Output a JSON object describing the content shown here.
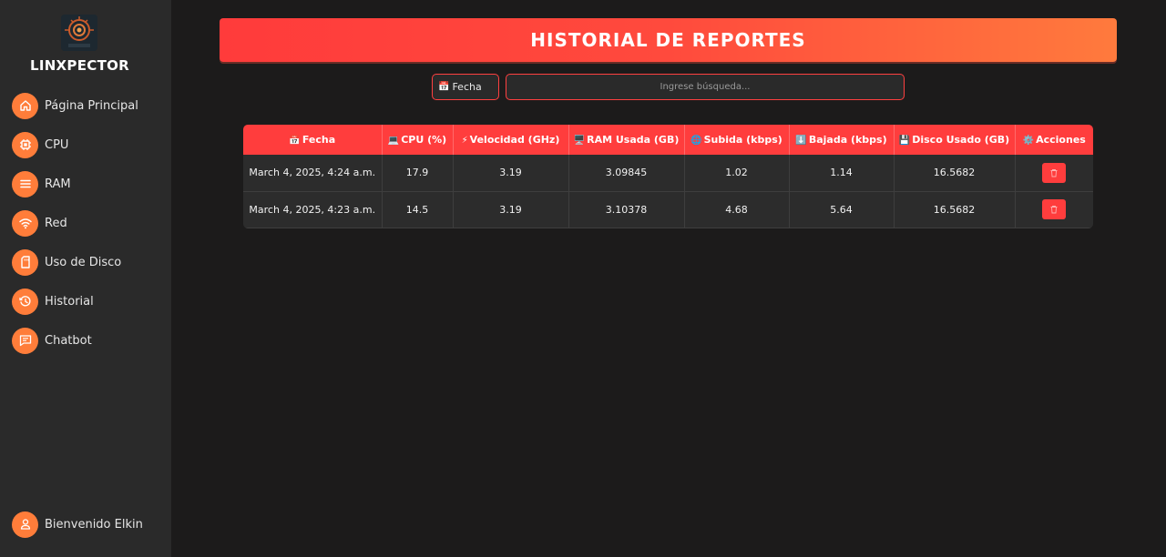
{
  "app": {
    "brand": "LINXPECTOR",
    "logo_text": "LINXPECTOR"
  },
  "sidebar": {
    "items": [
      {
        "label": "Página Principal",
        "icon": "home-icon"
      },
      {
        "label": "CPU",
        "icon": "cpu-icon"
      },
      {
        "label": "RAM",
        "icon": "list-icon"
      },
      {
        "label": "Red",
        "icon": "wifi-icon"
      },
      {
        "label": "Uso de Disco",
        "icon": "sd-card-icon"
      },
      {
        "label": "Historial",
        "icon": "history-icon"
      },
      {
        "label": "Chatbot",
        "icon": "chat-icon"
      }
    ],
    "user": {
      "label": "Bienvenido Elkin",
      "icon": "user-icon"
    }
  },
  "header": {
    "title": "HISTORIAL DE REPORTES"
  },
  "filters": {
    "date_icon": "📅",
    "date_label": "Fecha",
    "search_placeholder": "Ingrese búsqueda..."
  },
  "table": {
    "columns": [
      {
        "icon": "📅",
        "label": "Fecha"
      },
      {
        "icon": "💻",
        "label": "CPU (%)"
      },
      {
        "icon": "⚡",
        "label": "Velocidad (GHz)"
      },
      {
        "icon": "🖥️",
        "label": "RAM Usada (GB)"
      },
      {
        "icon": "🌐",
        "label": "Subida (kbps)"
      },
      {
        "icon": "⬇️",
        "label": "Bajada (kbps)"
      },
      {
        "icon": "💾",
        "label": "Disco Usado (GB)"
      },
      {
        "icon": "⚙️",
        "label": "Acciones"
      }
    ],
    "rows": [
      [
        "March 4, 2025, 4:24 a.m.",
        "17.9",
        "3.19",
        "3.09845",
        "1.02",
        "1.14",
        "16.5682"
      ],
      [
        "March 4, 2025, 4:23 a.m.",
        "14.5",
        "3.19",
        "3.10378",
        "4.68",
        "5.64",
        "16.5682"
      ]
    ],
    "action_icon": "trash-icon"
  },
  "colors": {
    "accent": "#ff3d3d",
    "accent_orange": "#ff7d3a",
    "background": "#1c1b1b",
    "sidebar": "#2a2a2a"
  }
}
